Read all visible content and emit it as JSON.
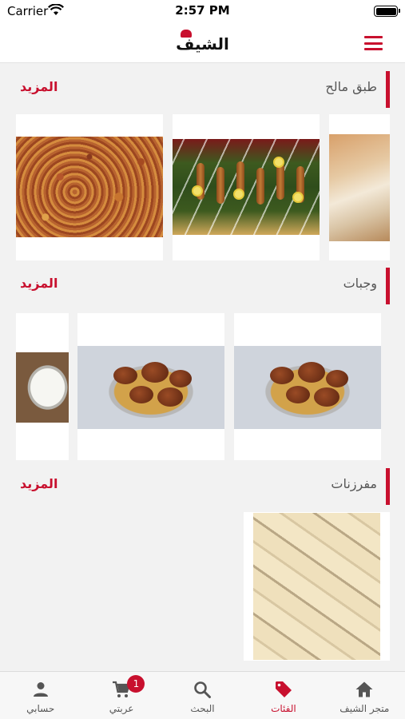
{
  "status_bar": {
    "carrier": "Carrier",
    "time": "2:57 PM"
  },
  "header": {
    "logo_text": "الشيف",
    "menu_icon": "hamburger-menu-icon"
  },
  "sections": [
    {
      "title": "طبق مالح",
      "more": "المزيد",
      "items": [
        "tomato-salad-photo",
        "sambusa-platter-photo",
        "bread-photo"
      ]
    },
    {
      "title": "وجبات",
      "more": "المزيد",
      "items": [
        "rice-platter-photo",
        "rice-platter-photo",
        "yogurt-dish-photo"
      ]
    },
    {
      "title": "مفرزنات",
      "more": "المزيد",
      "items": [
        "samosa-photo"
      ]
    }
  ],
  "tab_bar": {
    "tabs": [
      {
        "label": "متجر الشيف",
        "icon": "home-icon"
      },
      {
        "label": "الفئات",
        "icon": "tag-icon",
        "active": true
      },
      {
        "label": "البحث",
        "icon": "search-icon"
      },
      {
        "label": "عربتي",
        "icon": "cart-icon",
        "badge": "1"
      },
      {
        "label": "حسابي",
        "icon": "user-icon"
      }
    ]
  },
  "colors": {
    "accent": "#c8102e",
    "background": "#f2f2f2"
  }
}
